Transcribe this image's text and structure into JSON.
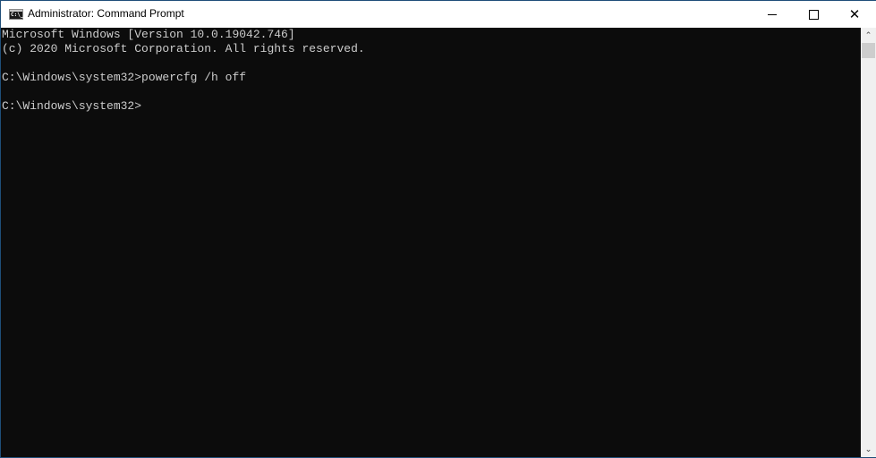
{
  "window": {
    "title": "Administrator: Command Prompt",
    "app_icon": "cmd-icon",
    "app_icon_text": "C:\\_",
    "controls": {
      "minimize_icon": "minimize-icon",
      "maximize_icon": "maximize-icon",
      "close_icon": "close-icon",
      "close_glyph": "✕"
    }
  },
  "terminal": {
    "lines": [
      "Microsoft Windows [Version 10.0.19042.746]",
      "(c) 2020 Microsoft Corporation. All rights reserved.",
      "",
      "C:\\Windows\\system32>powercfg /h off",
      "",
      "C:\\Windows\\system32>"
    ]
  },
  "scrollbar": {
    "up_glyph": "⌃",
    "down_glyph": "⌄"
  }
}
